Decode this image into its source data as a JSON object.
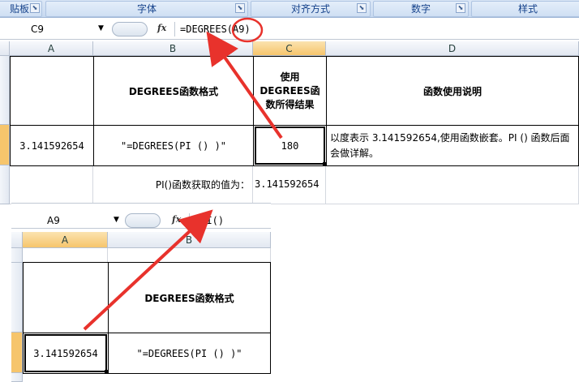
{
  "ribbon": {
    "groups": [
      "贴板",
      "字体",
      "对齐方式",
      "数字",
      "样式"
    ]
  },
  "top_formula_bar": {
    "name_box": "C9",
    "fx_label": "fx",
    "formula_prefix": "=DEGREES",
    "formula_highlight": "(A9)"
  },
  "top_sheet": {
    "column_headers": [
      "A",
      "B",
      "C",
      "D"
    ],
    "header_row": {
      "b": "DEGREES函数格式",
      "c": "使用DEGREES函数所得结果",
      "d": "函数使用说明"
    },
    "data_row": {
      "a": "3.141592654",
      "b": "\"=DEGREES(PI () )\"",
      "c": "180",
      "d": "以度表示 3.141592654,使用函数嵌套。PI () 函数后面会做详解。"
    },
    "note_label": "PI()函数获取的值为：",
    "note_value": "3.141592654"
  },
  "bottom_formula_bar": {
    "name_box": "A9",
    "fx_label": "fx",
    "formula": "=PI()"
  },
  "bottom_sheet": {
    "column_headers": [
      "A",
      "B"
    ],
    "header_b": "DEGREES函数格式",
    "data_a": "3.141592654",
    "data_b": "\"=DEGREES(PI () )\""
  },
  "colors": {
    "annotation_red": "#e8322c",
    "selected_header": "#f6c56c"
  }
}
